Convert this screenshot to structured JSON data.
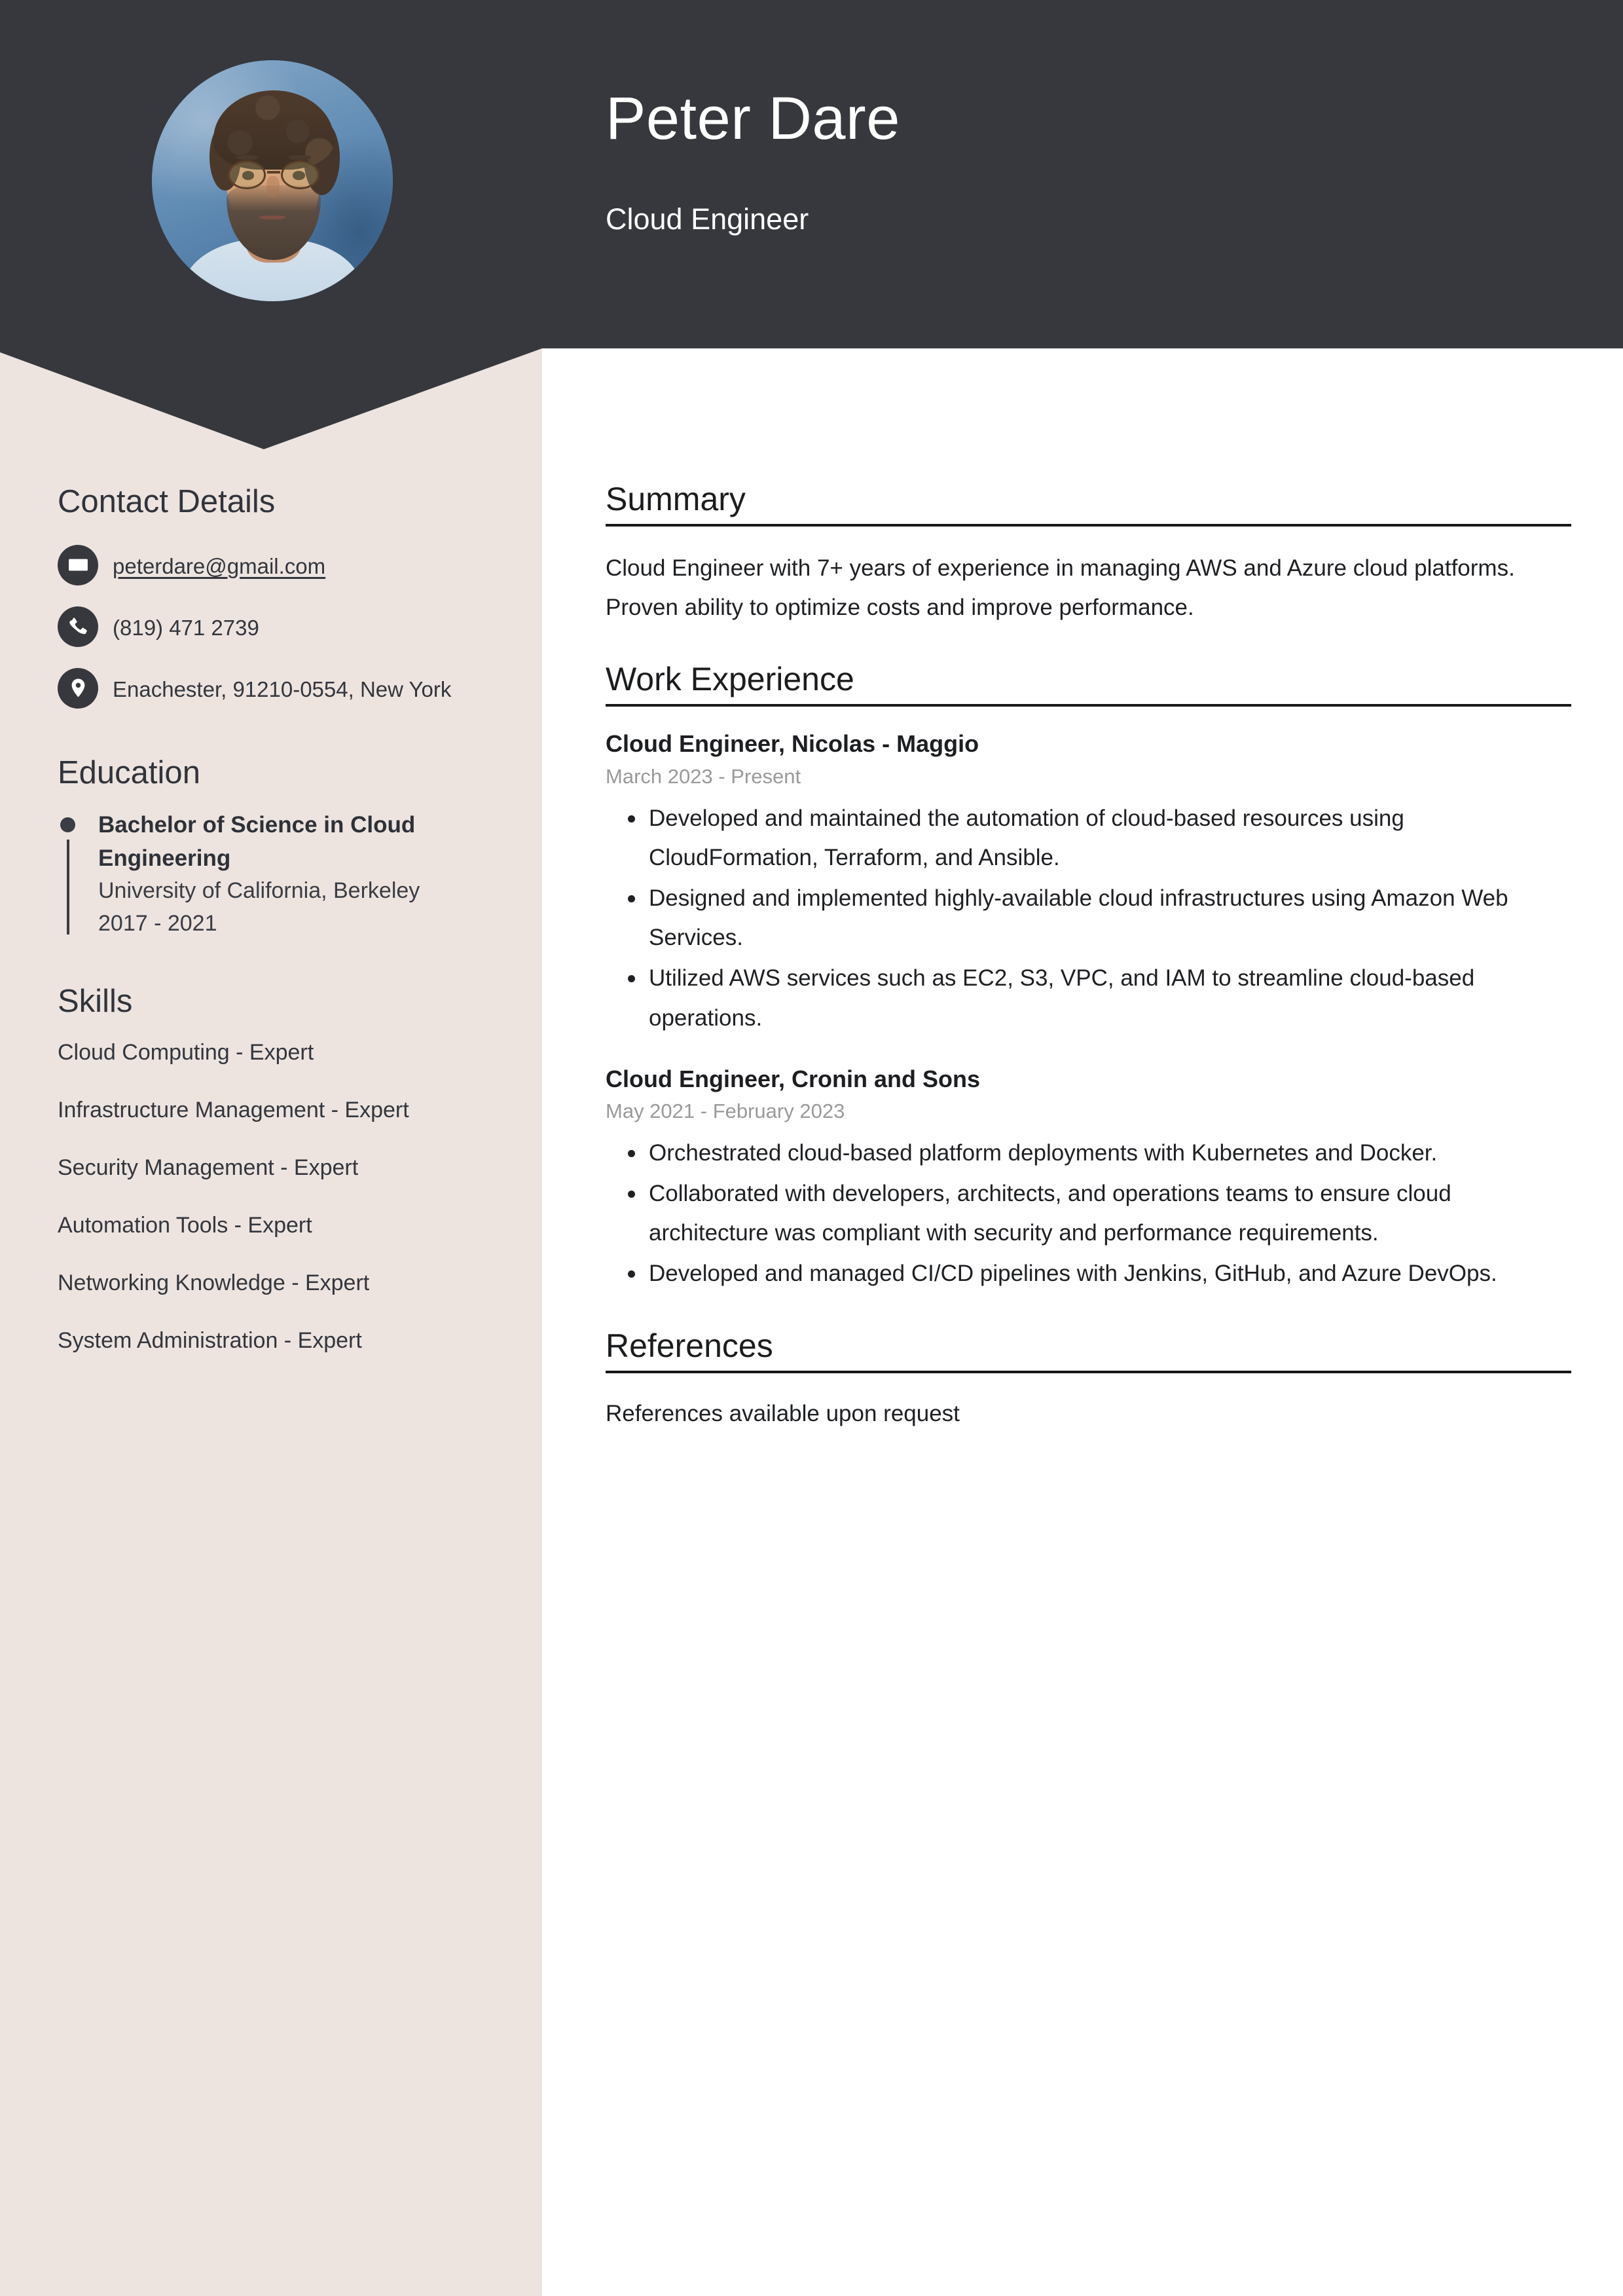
{
  "colors": {
    "header_dark": "#36383D",
    "sidebar_beige": "#EDE4E0",
    "page_white": "#FFFFFF",
    "heading_text": "#1B1C1E",
    "muted_date": "#9A9A9A"
  },
  "header": {
    "name": "Peter Dare",
    "job_title": "Cloud Engineer",
    "avatar_alt": "profile-photo"
  },
  "sidebar": {
    "contact": {
      "heading": "Contact Details",
      "items": [
        {
          "icon": "envelope-icon",
          "value": "peterdare@gmail.com",
          "is_link": true
        },
        {
          "icon": "phone-icon",
          "value": "(819) 471 2739",
          "is_link": false
        },
        {
          "icon": "map-pin-icon",
          "value": "Enachester, 91210-0554, New York",
          "is_link": false
        }
      ]
    },
    "education": {
      "heading": "Education",
      "items": [
        {
          "degree": "Bachelor of Science in Cloud Engineering",
          "school": "University of California, Berkeley",
          "years": "2017 - 2021"
        }
      ]
    },
    "skills": {
      "heading": "Skills",
      "items": [
        "Cloud Computing - Expert",
        "Infrastructure Management - Expert",
        "Security Management - Expert",
        "Automation Tools - Expert",
        "Networking Knowledge - Expert",
        "System Administration - Expert"
      ]
    }
  },
  "main": {
    "summary": {
      "heading": "Summary",
      "text": "Cloud Engineer with 7+ years of experience in managing AWS and Azure cloud platforms. Proven ability to optimize costs and improve performance."
    },
    "work_experience": {
      "heading": "Work Experience",
      "jobs": [
        {
          "title": "Cloud Engineer, Nicolas - Maggio",
          "dates": "March 2023 - Present",
          "bullets": [
            "Developed and maintained the automation of cloud-based resources using CloudFormation, Terraform, and Ansible.",
            "Designed and implemented highly-available cloud infrastructures using Amazon Web Services.",
            "Utilized AWS services such as EC2, S3, VPC, and IAM to streamline cloud-based operations."
          ]
        },
        {
          "title": "Cloud Engineer, Cronin and Sons",
          "dates": "May 2021 - February 2023",
          "bullets": [
            "Orchestrated cloud-based platform deployments with Kubernetes and Docker.",
            "Collaborated with developers, architects, and operations teams to ensure cloud architecture was compliant with security and performance requirements.",
            "Developed and managed CI/CD pipelines with Jenkins, GitHub, and Azure DevOps."
          ]
        }
      ]
    },
    "references": {
      "heading": "References",
      "text": "References available upon request"
    }
  }
}
